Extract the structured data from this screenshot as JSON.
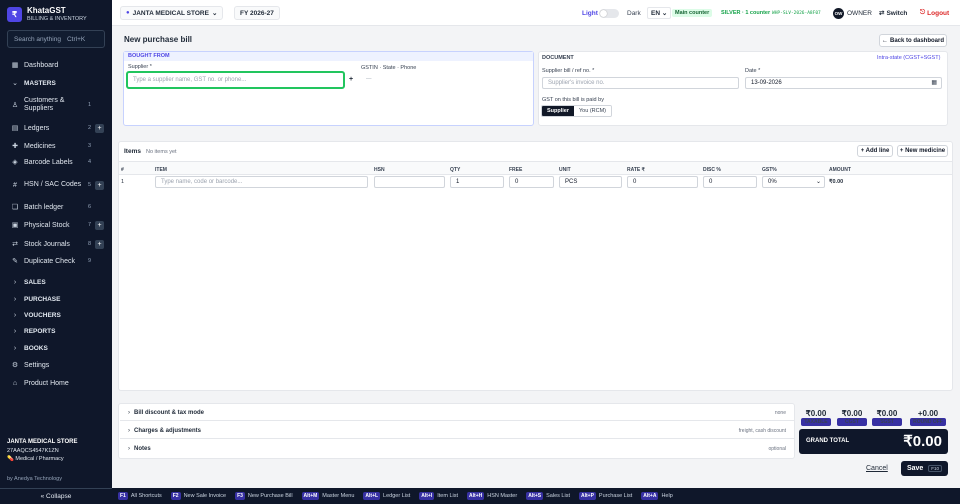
{
  "app": {
    "logo": "₹",
    "name": "KhataGST",
    "tagline": "BILLING & INVENTORY"
  },
  "search": {
    "placeholder": "Search anything",
    "shortcut": "Ctrl+K"
  },
  "sidebar": {
    "items": [
      {
        "icon": "dashboard-icon",
        "glyph": "▦",
        "label": "Dashboard",
        "count": "",
        "plus": false,
        "group": false
      },
      {
        "icon": "chevron-down-icon",
        "glyph": "⌄",
        "label": "MASTERS",
        "count": "",
        "plus": false,
        "group": true
      },
      {
        "icon": "users-icon",
        "glyph": "♙",
        "label": "Customers & Suppliers",
        "count": "1",
        "plus": false,
        "group": false
      },
      {
        "icon": "ledger-icon",
        "glyph": "▤",
        "label": "Ledgers",
        "count": "2",
        "plus": true,
        "group": false
      },
      {
        "icon": "pill-icon",
        "glyph": "✚",
        "label": "Medicines",
        "count": "3",
        "plus": false,
        "group": false
      },
      {
        "icon": "tag-icon",
        "glyph": "◈",
        "label": "Barcode Labels",
        "count": "4",
        "plus": false,
        "group": false
      },
      {
        "icon": "hash-icon",
        "glyph": "#",
        "label": "HSN / SAC Codes",
        "count": "5",
        "plus": true,
        "group": false
      },
      {
        "icon": "layers-icon",
        "glyph": "❏",
        "label": "Batch ledger",
        "count": "6",
        "plus": false,
        "group": false
      },
      {
        "icon": "box-icon",
        "glyph": "▣",
        "label": "Physical Stock",
        "count": "7",
        "plus": true,
        "group": false
      },
      {
        "icon": "exchange-icon",
        "glyph": "⇄",
        "label": "Stock Journals",
        "count": "8",
        "plus": true,
        "group": false
      },
      {
        "icon": "edit-icon",
        "glyph": "✎",
        "label": "Duplicate Check",
        "count": "9",
        "plus": false,
        "group": false
      },
      {
        "icon": "chevron-right-icon",
        "glyph": "›",
        "label": "SALES",
        "count": "",
        "plus": false,
        "group": true
      },
      {
        "icon": "chevron-right-icon",
        "glyph": "›",
        "label": "PURCHASE",
        "count": "",
        "plus": false,
        "group": true
      },
      {
        "icon": "chevron-right-icon",
        "glyph": "›",
        "label": "VOUCHERS",
        "count": "",
        "plus": false,
        "group": true
      },
      {
        "icon": "chevron-right-icon",
        "glyph": "›",
        "label": "REPORTS",
        "count": "",
        "plus": false,
        "group": true
      },
      {
        "icon": "chevron-right-icon",
        "glyph": "›",
        "label": "BOOKS",
        "count": "",
        "plus": false,
        "group": true
      },
      {
        "icon": "gear-icon",
        "glyph": "⚙",
        "label": "Settings",
        "count": "",
        "plus": false,
        "group": false
      },
      {
        "icon": "home-icon",
        "glyph": "⌂",
        "label": "Product Home",
        "count": "",
        "plus": false,
        "group": false
      }
    ],
    "store_name": "JANTA MEDICAL STORE",
    "gstin": "27AAQCS4547K1ZN",
    "store_type": "Medical / Pharmacy",
    "byline": "by Anedya Technology",
    "collapse": "« Collapse"
  },
  "topbar": {
    "store": "JANTA MEDICAL STORE",
    "fy": "FY 2026-27",
    "light": "Light",
    "dark": "Dark",
    "lang": "EN",
    "counter": "Main counter",
    "plan": "SILVER · 1 counter",
    "device": "WHP-SLV-2026-A8F07",
    "avatar": "OW",
    "role": "OWNER",
    "switch": "Switch",
    "logout": "Logout"
  },
  "page": {
    "title": "New purchase bill",
    "back": "Back to dashboard"
  },
  "bought_from": {
    "section": "BOUGHT FROM",
    "supplier_label": "Supplier *",
    "supplier_placeholder": "Type a supplier name, GST no. or phone...",
    "add": "+",
    "gstin_label": "GSTIN · State · Phone",
    "gstin_value": "—"
  },
  "document": {
    "section": "DOCUMENT",
    "mode": "Intra-state (CGST+SGST)",
    "ref_label": "Supplier bill / ref no. *",
    "ref_placeholder": "Supplier's invoice no.",
    "date_label": "Date *",
    "date_value": "13-09-2026",
    "gst_label": "GST on this bill is paid by",
    "opt_supplier": "Supplier",
    "opt_rcm": "You (RCM)"
  },
  "items": {
    "title": "Items",
    "status": "No items yet",
    "add_line": "+ Add line",
    "new_medicine": "+ New medicine",
    "headers": [
      "#",
      "ITEM",
      "HSN",
      "QTY",
      "FREE",
      "UNIT",
      "RATE ₹",
      "DISC %",
      "GST%",
      "AMOUNT"
    ],
    "row": {
      "num": "1",
      "item_placeholder": "Type name, code or barcode...",
      "hsn": "",
      "qty": "1",
      "free": "0",
      "unit": "PCS",
      "rate": "0",
      "disc": "0",
      "gst": "0%",
      "amount": "₹0.00"
    }
  },
  "footer_sections": [
    {
      "label": "Bill discount & tax mode",
      "hint": "none"
    },
    {
      "label": "Charges & adjustments",
      "hint": "freight, cash discount"
    },
    {
      "label": "Notes",
      "hint": "optional"
    }
  ],
  "totals": [
    {
      "value": "₹0.00",
      "label": "TAXABLE"
    },
    {
      "value": "₹0.00",
      "label": "CGST"
    },
    {
      "value": "₹0.00",
      "label": "SGST"
    },
    {
      "value": "+0.00",
      "label": "ROUND OFF"
    }
  ],
  "grand": {
    "label": "GRAND TOTAL",
    "value": "₹0.00"
  },
  "actions": {
    "cancel": "Cancel",
    "save": "Save",
    "save_key": "F10"
  },
  "shortcuts": [
    {
      "key": "F1",
      "label": "All Shortcuts"
    },
    {
      "key": "F2",
      "label": "New Sale Invoice"
    },
    {
      "key": "F3",
      "label": "New Purchase Bill"
    },
    {
      "key": "Alt+M",
      "label": "Master Menu"
    },
    {
      "key": "Alt+L",
      "label": "Ledger List"
    },
    {
      "key": "Alt+I",
      "label": "Item List"
    },
    {
      "key": "Alt+H",
      "label": "HSN Master"
    },
    {
      "key": "Alt+S",
      "label": "Sales List"
    },
    {
      "key": "Alt+P",
      "label": "Purchase List"
    },
    {
      "key": "Alt+A",
      "label": "Help"
    }
  ],
  "colors": {
    "sidebar": "#0f172a",
    "accent": "#4f46e5",
    "focus": "#16a34a",
    "danger": "#dc2626",
    "plan": "#16a34a"
  }
}
